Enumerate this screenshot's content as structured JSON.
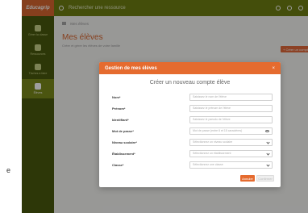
{
  "outside_text": "e",
  "app": {
    "logo": "Educagrip"
  },
  "sidebar": {
    "items": [
      {
        "label": "Gérer la classe",
        "active": false
      },
      {
        "label": "Ressources",
        "active": false
      },
      {
        "label": "Tâches à faire",
        "active": false
      },
      {
        "label": "Élèves",
        "active": true
      }
    ]
  },
  "topbar": {
    "search_placeholder": "Rechercher une ressource"
  },
  "breadcrumb": "Mes élèves",
  "page": {
    "title": "Mes élèves",
    "subtitle": "Créer et gérer les élèves de votre famille",
    "create_button": "+ Créer un compte"
  },
  "modal": {
    "title": "Gestion de mes élèves",
    "close": "×",
    "subtitle": "Créer un nouveau compte élève",
    "fields": [
      {
        "label": "Nom*",
        "placeholder": "Saisissez le nom de l'élève",
        "type": "text"
      },
      {
        "label": "Prénom*",
        "placeholder": "Saisissez le prénom de l'élève",
        "type": "text"
      },
      {
        "label": "Identifiant*",
        "placeholder": "Saisissez le pseudo de l'élève",
        "type": "text"
      },
      {
        "label": "Mot de passe*",
        "placeholder": "Mot de passe (entre 6 et 15 caractères)",
        "type": "password"
      },
      {
        "label": "Niveau scolaire*",
        "placeholder": "Sélectionnez un niveau scolaire",
        "type": "select"
      },
      {
        "label": "Établissement*",
        "placeholder": "Sélectionnez un établissement",
        "type": "select"
      },
      {
        "label": "Classe*",
        "placeholder": "Sélectionnez une classe",
        "type": "select"
      }
    ],
    "cancel_label": "Annuler",
    "confirm_label": "Confirmer"
  },
  "colors": {
    "accent": "#e56b2f",
    "sidebar": "#4a5a0e",
    "topbar": "#6e7e12"
  }
}
